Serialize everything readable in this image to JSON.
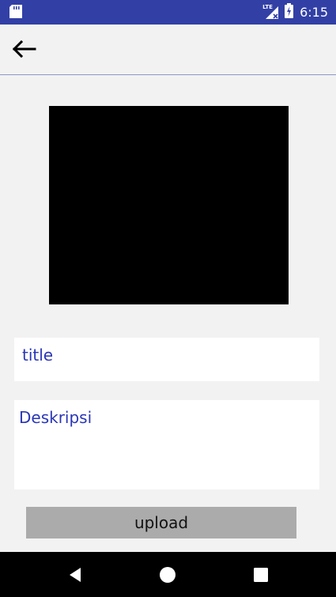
{
  "status_bar": {
    "time": "6:15",
    "network_label": "LTE",
    "icons": [
      "sd-card-icon",
      "signal-icon",
      "battery-charging-icon"
    ],
    "background": "#3240a6"
  },
  "toolbar": {
    "back_icon": "arrow-left-icon"
  },
  "form": {
    "title_placeholder": "title",
    "description_placeholder": "Deskripsi",
    "upload_label": "upload",
    "accent_color": "#2a36b7",
    "button_color": "#ababab"
  },
  "nav_bar": {
    "icons": [
      "back-triangle-icon",
      "home-circle-icon",
      "recents-square-icon"
    ]
  }
}
